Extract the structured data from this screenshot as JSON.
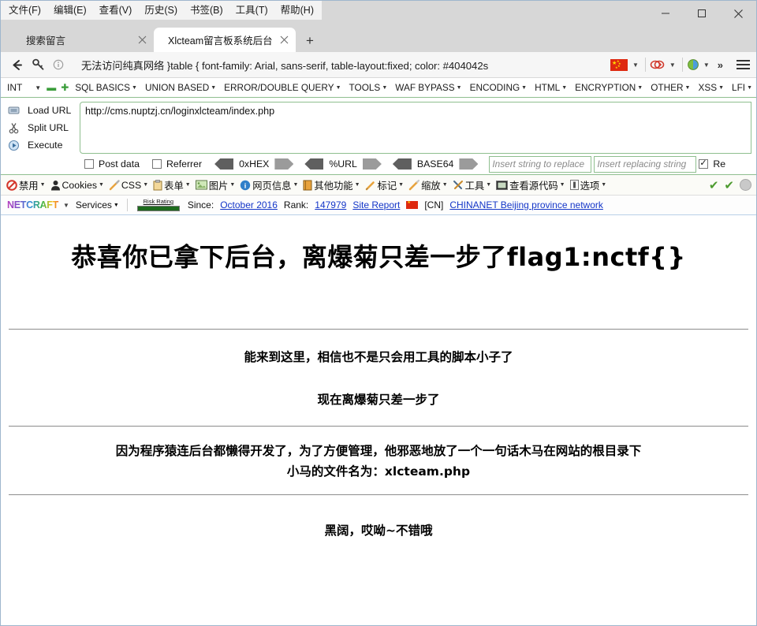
{
  "window": {
    "menu": [
      {
        "label": "文件(F)",
        "accel": "F"
      },
      {
        "label": "编辑(E)",
        "accel": "E"
      },
      {
        "label": "查看(V)",
        "accel": "V"
      },
      {
        "label": "历史(S)",
        "accel": "S"
      },
      {
        "label": "书签(B)",
        "accel": "B"
      },
      {
        "label": "工具(T)",
        "accel": "T"
      },
      {
        "label": "帮助(H)",
        "accel": "H"
      }
    ],
    "controls": {
      "minimize": "minimize",
      "maximize": "maximize",
      "close": "close"
    }
  },
  "tabs": [
    {
      "label": "搜索留言",
      "active": false
    },
    {
      "label": "Xlcteam留言板系统后台",
      "active": true
    }
  ],
  "newtab_label": "+",
  "navbar": {
    "back_icon": "back-arrow-icon",
    "key_icon": "key-icon",
    "info_icon": "info-icon",
    "address_value": "无法访问纯真网络  }table { font-family: Arial, sans-serif, table-layout:fixed; color: #404042s",
    "flag_label": "CN",
    "extension_icons": [
      "globe-icon",
      "cookie-swirl-icon"
    ],
    "overflow_label": "»",
    "menu_icon": "hamburger-menu-icon"
  },
  "sqlbar": {
    "type_select": "INT",
    "remove_icon": "minus-icon",
    "add_icon": "plus-icon",
    "items": [
      "SQL BASICS",
      "UNION BASED",
      "ERROR/DOUBLE QUERY",
      "TOOLS",
      "WAF BYPASS",
      "ENCODING",
      "HTML",
      "ENCRYPTION",
      "OTHER",
      "XSS",
      "LFI"
    ]
  },
  "hackbar": {
    "actions": [
      {
        "label": "Load URL",
        "icon": "load-url-icon"
      },
      {
        "label": "Split URL",
        "icon": "split-url-icon"
      },
      {
        "label": "Execute",
        "icon": "execute-icon"
      }
    ],
    "url_value": "http://cms.nuptzj.cn/loginxlcteam/index.php",
    "checkboxes": [
      {
        "label": "Post data",
        "checked": false
      },
      {
        "label": "Referrer",
        "checked": false
      }
    ],
    "encoders": [
      "0xHEX",
      "%URL",
      "BASE64"
    ],
    "replace_find_placeholder": "Insert string to replace",
    "replace_with_placeholder": "Insert replacing string",
    "replace_checkbox": {
      "label": "Re",
      "checked": true
    }
  },
  "cnbar": {
    "items": [
      {
        "label": "禁用",
        "icon": "disable-icon"
      },
      {
        "label": "Cookies",
        "icon": "cookie-person-icon"
      },
      {
        "label": "CSS",
        "icon": "wand-icon"
      },
      {
        "label": "表单",
        "icon": "clipboard-icon"
      },
      {
        "label": "图片",
        "icon": "image-icon"
      },
      {
        "label": "网页信息",
        "icon": "info-circle-icon"
      },
      {
        "label": "其他功能",
        "icon": "book-icon"
      },
      {
        "label": "标记",
        "icon": "pencil-icon"
      },
      {
        "label": "缩放",
        "icon": "ruler-icon"
      },
      {
        "label": "工具",
        "icon": "tools-icon"
      },
      {
        "label": "查看源代码",
        "icon": "source-code-icon"
      },
      {
        "label": "选项",
        "icon": "options-icon"
      }
    ],
    "status_icons": [
      "check-green-icon",
      "check-green-icon",
      "grey-circle-icon"
    ]
  },
  "netcraft": {
    "logo": "NETCRAFT",
    "services_label": "Services",
    "risk_label": "Risk Rating",
    "since_label": "Since:",
    "since_value": "October 2016",
    "rank_label": "Rank:",
    "rank_value": "147979",
    "site_report": "Site Report",
    "country_code": "[CN]",
    "network": "CHINANET Beijing province network"
  },
  "content": {
    "heading": "恭喜你已拿下后台，离爆菊只差一步了flag1:nctf{}",
    "section1": [
      "能来到这里，相信也不是只会用工具的脚本小子了",
      "现在离爆菊只差一步了"
    ],
    "section2": [
      "因为程序猿连后台都懒得开发了，为了方便管理，他邪恶地放了一个一句话木马在网站的根目录下",
      "小马的文件名为：xlcteam.php"
    ],
    "section3": [
      "黑阔，哎呦~不错哦"
    ]
  },
  "colors": {
    "accent_green": "#8fbf8f",
    "link_blue": "#1436c8",
    "tab_active_bg": "#ffffff",
    "chrome_bg": "#d7d7d7",
    "flag_red": "#de2910"
  }
}
